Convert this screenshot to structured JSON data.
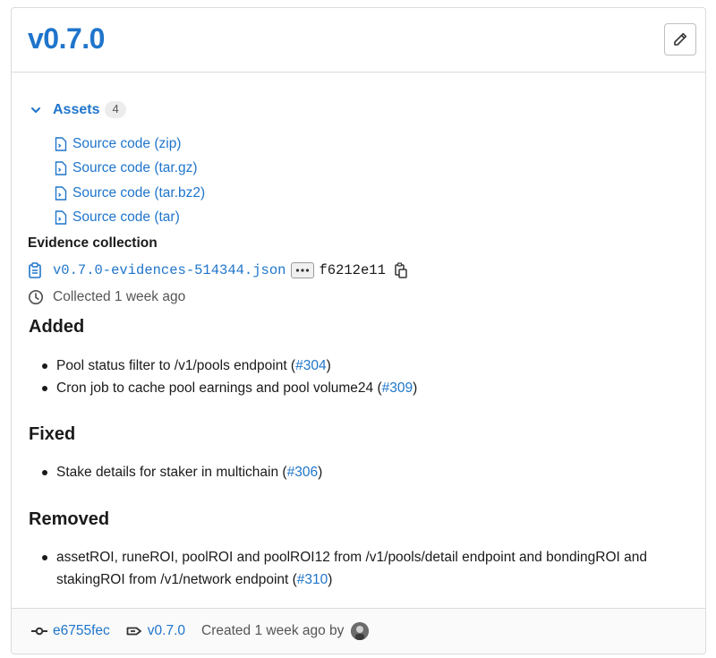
{
  "release": {
    "title": "v0.7.0"
  },
  "assets": {
    "label": "Assets",
    "count": "4",
    "items": [
      {
        "label": "Source code (zip)"
      },
      {
        "label": "Source code (tar.gz)"
      },
      {
        "label": "Source code (tar.bz2)"
      },
      {
        "label": "Source code (tar)"
      }
    ]
  },
  "evidence": {
    "title": "Evidence collection",
    "file": "v0.7.0-evidences-514344.json",
    "sha": "f6212e11",
    "collected": "Collected 1 week ago"
  },
  "notes": {
    "added": {
      "heading": "Added",
      "items": [
        {
          "text": "Pool status filter to /v1/pools endpoint (",
          "link": "#304",
          "after": ")"
        },
        {
          "text": "Cron job to cache pool earnings and pool volume24 (",
          "link": "#309",
          "after": ")"
        }
      ]
    },
    "fixed": {
      "heading": "Fixed",
      "items": [
        {
          "text": "Stake details for staker in multichain (",
          "link": "#306",
          "after": ")"
        }
      ]
    },
    "removed": {
      "heading": "Removed",
      "items": [
        {
          "text": "assetROI, runeROI, poolROI and poolROI12 from /v1/pools/detail endpoint and bondingROI and stakingROI from /v1/network endpoint (",
          "link": "#310",
          "after": ")"
        }
      ]
    }
  },
  "footer": {
    "commit": "e6755fec",
    "tag": "v0.7.0",
    "created": "Created 1 week ago by"
  },
  "colors": {
    "link": "#1f75cb",
    "text": "#2e2e2e",
    "border": "#dbdbdb"
  }
}
